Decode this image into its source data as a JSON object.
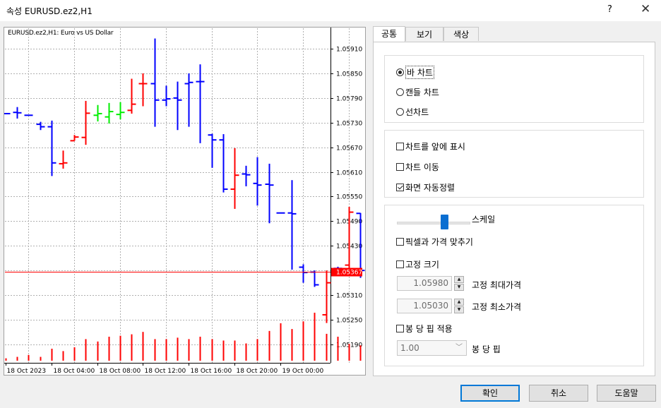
{
  "window": {
    "title": "속성 EURUSD.ez2,H1",
    "help_label": "?",
    "close_label": "✕"
  },
  "chart": {
    "header": "EURUSD.ez2,H1:  Euro vs US Dollar"
  },
  "chart_data": {
    "type": "bar",
    "title": "EURUSD.ez2,H1:  Euro vs US Dollar",
    "y_ticks": [
      "1.05910",
      "1.05850",
      "1.05790",
      "1.05730",
      "1.05670",
      "1.05610",
      "1.05550",
      "1.05490",
      "1.05430",
      "1.05370",
      "1.05310",
      "1.05250",
      "1.05190"
    ],
    "ylim": [
      1.05145,
      1.0596
    ],
    "current_price": "1.05367",
    "x_ticks": [
      "18 Oct 2023",
      "18 Oct 04:00",
      "18 Oct 08:00",
      "18 Oct 12:00",
      "18 Oct 16:00",
      "18 Oct 20:00",
      "19 Oct 00:00"
    ],
    "grid": true,
    "colors": {
      "bull": "#ff0000",
      "bear": "#0000ff",
      "doji": "#00ee00",
      "price_line": "#ff0000",
      "volume": "#ff0000"
    },
    "bars": [
      {
        "o": 1.05752,
        "h": 1.05752,
        "l": 1.05752,
        "c": 1.05752,
        "d": "bear"
      },
      {
        "o": 1.05755,
        "h": 1.05768,
        "l": 1.0574,
        "c": 1.05754,
        "d": "bear"
      },
      {
        "o": 1.05748,
        "h": 1.05748,
        "l": 1.05748,
        "c": 1.05748,
        "d": "bear"
      },
      {
        "o": 1.05726,
        "h": 1.05732,
        "l": 1.05712,
        "c": 1.0572,
        "d": "bear"
      },
      {
        "o": 1.0572,
        "h": 1.05735,
        "l": 1.056,
        "c": 1.05632,
        "d": "bear"
      },
      {
        "o": 1.0563,
        "h": 1.05662,
        "l": 1.05618,
        "c": 1.05632,
        "d": "bull"
      },
      {
        "o": 1.05686,
        "h": 1.057,
        "l": 1.05686,
        "c": 1.05695,
        "d": "bull"
      },
      {
        "o": 1.05694,
        "h": 1.05783,
        "l": 1.05676,
        "c": 1.05753,
        "d": "bull"
      },
      {
        "o": 1.05748,
        "h": 1.05773,
        "l": 1.05733,
        "c": 1.05752,
        "d": "doji"
      },
      {
        "o": 1.05744,
        "h": 1.05778,
        "l": 1.05728,
        "c": 1.05757,
        "d": "doji"
      },
      {
        "o": 1.0575,
        "h": 1.0578,
        "l": 1.05738,
        "c": 1.05755,
        "d": "doji"
      },
      {
        "o": 1.0576,
        "h": 1.05837,
        "l": 1.05752,
        "c": 1.05775,
        "d": "bull"
      },
      {
        "o": 1.05825,
        "h": 1.0585,
        "l": 1.0577,
        "c": 1.05825,
        "d": "bull"
      },
      {
        "o": 1.05825,
        "h": 1.05935,
        "l": 1.0572,
        "c": 1.05785,
        "d": "bear"
      },
      {
        "o": 1.05785,
        "h": 1.0582,
        "l": 1.0577,
        "c": 1.05788,
        "d": "bear"
      },
      {
        "o": 1.0579,
        "h": 1.0583,
        "l": 1.05712,
        "c": 1.05785,
        "d": "bear"
      },
      {
        "o": 1.05825,
        "h": 1.0585,
        "l": 1.0572,
        "c": 1.05828,
        "d": "bear"
      },
      {
        "o": 1.0583,
        "h": 1.05872,
        "l": 1.0568,
        "c": 1.0583,
        "d": "bear"
      },
      {
        "o": 1.057,
        "h": 1.05703,
        "l": 1.0562,
        "c": 1.05688,
        "d": "bear"
      },
      {
        "o": 1.05688,
        "h": 1.05702,
        "l": 1.0556,
        "c": 1.05568,
        "d": "bear"
      },
      {
        "o": 1.05568,
        "h": 1.05668,
        "l": 1.0552,
        "c": 1.05602,
        "d": "bull"
      },
      {
        "o": 1.05605,
        "h": 1.05625,
        "l": 1.05575,
        "c": 1.05603,
        "d": "bear"
      },
      {
        "o": 1.05582,
        "h": 1.05646,
        "l": 1.05528,
        "c": 1.05578,
        "d": "bear"
      },
      {
        "o": 1.0558,
        "h": 1.0563,
        "l": 1.05485,
        "c": 1.05578,
        "d": "bear"
      },
      {
        "o": 1.0551,
        "h": 1.0551,
        "l": 1.0551,
        "c": 1.0551,
        "d": "bear"
      },
      {
        "o": 1.0551,
        "h": 1.0559,
        "l": 1.05372,
        "c": 1.05508,
        "d": "bear"
      },
      {
        "o": 1.05378,
        "h": 1.05385,
        "l": 1.0534,
        "c": 1.05365,
        "d": "bear"
      },
      {
        "o": 1.05366,
        "h": 1.0537,
        "l": 1.0533,
        "c": 1.05335,
        "d": "bear"
      },
      {
        "o": 1.05262,
        "h": 1.0537,
        "l": 1.05242,
        "c": 1.0534,
        "d": "bull"
      },
      {
        "o": 1.05375,
        "h": 1.05379,
        "l": 1.0537,
        "c": 1.05375,
        "d": "bear"
      },
      {
        "o": 1.05383,
        "h": 1.05525,
        "l": 1.05356,
        "c": 1.05512,
        "d": "bull"
      },
      {
        "o": 1.05509,
        "h": 1.0551,
        "l": 1.05352,
        "c": 1.0537,
        "d": "bear"
      },
      {
        "o": 1.05355,
        "h": 1.05375,
        "l": 1.05353,
        "c": 1.0536,
        "d": "bull"
      },
      {
        "o": 1.0536,
        "h": 1.05376,
        "l": 1.05346,
        "c": 1.05358,
        "d": "bear"
      },
      {
        "o": 1.05358,
        "h": 1.0538,
        "l": 1.05343,
        "c": 1.0536,
        "d": "bull"
      },
      {
        "o": 1.05357,
        "h": 1.05376,
        "l": 1.05338,
        "c": 1.05355,
        "d": "bull"
      },
      {
        "o": 1.05358,
        "h": 1.05377,
        "l": 1.05355,
        "c": 1.0537,
        "d": "bull"
      },
      {
        "o": 1.05373,
        "h": 1.05385,
        "l": 1.05352,
        "c": 1.0538,
        "d": "bull"
      },
      {
        "o": 1.05372,
        "h": 1.0539,
        "l": 1.05362,
        "c": 1.05375,
        "d": "bull"
      },
      {
        "o": 1.0537,
        "h": 1.05397,
        "l": 1.0533,
        "c": 1.05367,
        "d": "bear"
      }
    ],
    "volumes": [
      0.05,
      0.08,
      0.12,
      0.08,
      0.25,
      0.2,
      0.28,
      0.45,
      0.4,
      0.5,
      0.52,
      0.55,
      0.6,
      0.45,
      0.45,
      0.48,
      0.45,
      0.5,
      0.45,
      0.42,
      0.42,
      0.36,
      0.45,
      0.62,
      0.78,
      0.66,
      0.82,
      1.0,
      0.56,
      0.5,
      0.35,
      0.32,
      0.35,
      0.12,
      0.12,
      0.12,
      0.12,
      0.12,
      0.12,
      0.12
    ]
  },
  "tabs": [
    {
      "label": "공통",
      "active": true
    },
    {
      "label": "보기",
      "active": false
    },
    {
      "label": "색상",
      "active": false
    }
  ],
  "chart_type": {
    "options": [
      "바 차트",
      "캔들 차트",
      "선차트"
    ],
    "selected": "바 차트"
  },
  "display": {
    "foreground": {
      "label": "차트를 앞에 표시",
      "checked": false
    },
    "shift": {
      "label": "차트 이동",
      "checked": false
    },
    "autoscroll": {
      "label": "화면 자동정렬",
      "checked": true
    }
  },
  "scale": {
    "label": "스케일",
    "level": 0.6,
    "fit_price": {
      "label": "픽셀과 가격 맞추기",
      "checked": false
    },
    "fixed": {
      "label": "고정 크기",
      "checked": false
    },
    "fixed_max": {
      "value": "1.05980",
      "label": "고정 최대가격"
    },
    "fixed_min": {
      "value": "1.05030",
      "label": "고정 최소가격"
    },
    "pips_per_bar": {
      "label": "봉 당 핍 적용",
      "checked": false
    },
    "pips_value": {
      "value": "1.00",
      "label": "봉 당 핍"
    }
  },
  "buttons": {
    "ok": "확인",
    "cancel": "취소",
    "help": "도움말"
  }
}
